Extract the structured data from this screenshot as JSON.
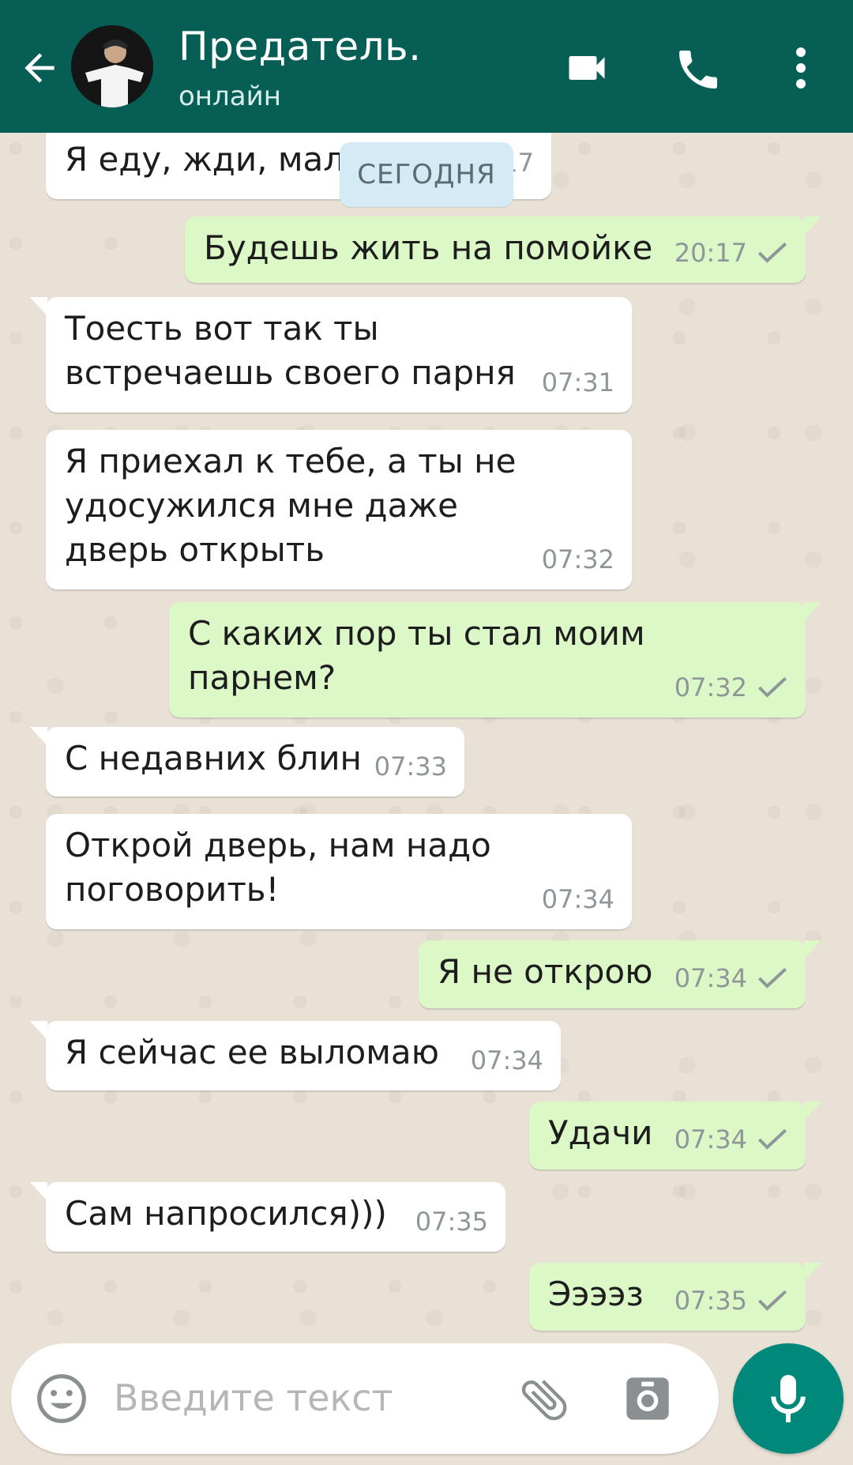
{
  "header": {
    "contact_name": "Предатель.",
    "status": "онлайн"
  },
  "chat": {
    "date_label": "СЕГОДНЯ",
    "messages": [
      {
        "dir": "in",
        "text": "Я еду, жди, малыш",
        "time": "20:17"
      },
      {
        "dir": "out",
        "text": "Будешь жить на помойке",
        "time": "20:17"
      },
      {
        "dir": "in",
        "text": "Тоесть вот так ты\nвстречаешь своего парня",
        "time": "07:31"
      },
      {
        "dir": "in",
        "text": "Я приехал к тебе, а ты не\nудосужился мне даже\nдверь открыть",
        "time": "07:32"
      },
      {
        "dir": "out",
        "text": "С каких пор ты стал моим\nпарнем?",
        "time": "07:32"
      },
      {
        "dir": "in",
        "text": "С недавних блин",
        "time": "07:33"
      },
      {
        "dir": "in",
        "text": "Открой дверь, нам надо\nпоговорить!",
        "time": "07:34"
      },
      {
        "dir": "out",
        "text": "Я не открою",
        "time": "07:34"
      },
      {
        "dir": "in",
        "text": " Я сейчас ее выломаю",
        "time": "07:34"
      },
      {
        "dir": "out",
        "text": "Удачи",
        "time": "07:34"
      },
      {
        "dir": "in",
        "text": "Сам напросился)))",
        "time": "07:35"
      },
      {
        "dir": "out",
        "text": "Ээээз",
        "time": "07:35"
      }
    ]
  },
  "composer": {
    "placeholder": "Введите текст"
  },
  "colors": {
    "header_bg": "#075e54",
    "outgoing_bubble": "#dcf8c6",
    "incoming_bubble": "#ffffff",
    "mic_button": "#00897b"
  },
  "icons": [
    "back-arrow-icon",
    "video-call-icon",
    "phone-icon",
    "more-options-icon",
    "emoji-icon",
    "attach-icon",
    "camera-icon",
    "microphone-icon",
    "read-check-icon"
  ]
}
